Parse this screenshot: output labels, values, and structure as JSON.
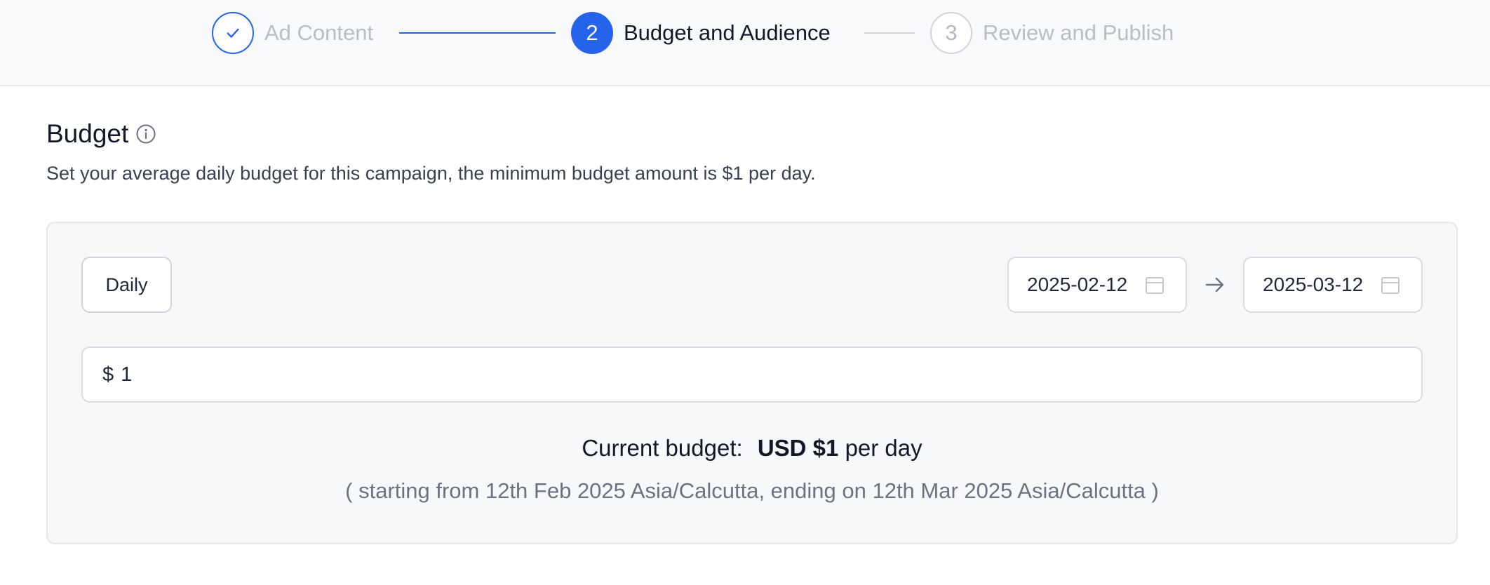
{
  "stepper": {
    "steps": [
      {
        "number": "",
        "label": "Ad Content",
        "state": "completed"
      },
      {
        "number": "2",
        "label": "Budget and Audience",
        "state": "active"
      },
      {
        "number": "3",
        "label": "Review and Publish",
        "state": "upcoming"
      }
    ]
  },
  "budget": {
    "title": "Budget",
    "description": "Set your average daily budget for this campaign, the minimum budget amount is $1 per day.",
    "frequency": "Daily",
    "start_date": "2025-02-12",
    "end_date": "2025-03-12",
    "currency_symbol": "$",
    "amount": "1",
    "summary_prefix": "Current budget:",
    "summary_amount": "USD $1",
    "summary_suffix": "per day",
    "period_text": "( starting from 12th Feb 2025 Asia/Calcutta, ending on 12th Mar 2025 Asia/Calcutta )"
  },
  "colors": {
    "accent": "#2563eb",
    "muted_text": "#b9bdc5",
    "panel_bg": "#f7f8fa"
  },
  "icons": {
    "completed_step": "check-icon",
    "info": "info-icon",
    "date": "calendar-icon",
    "range": "arrow-right-icon"
  }
}
